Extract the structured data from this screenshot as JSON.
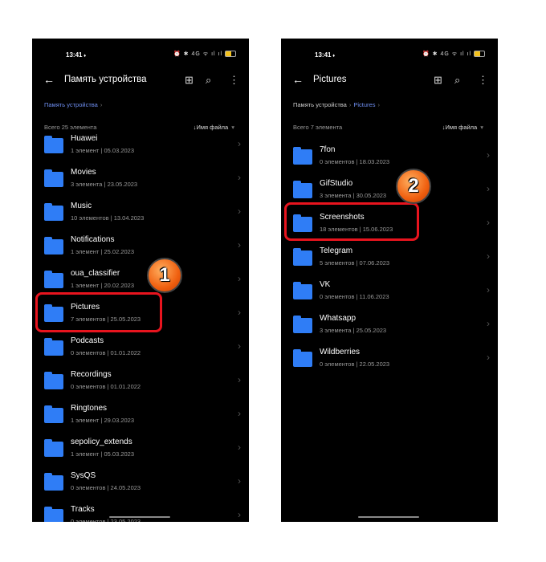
{
  "status": {
    "time": "13:41",
    "icons": "⏰ ✱ 4G ᯤ ıl ıl"
  },
  "left": {
    "title": "Память устройства",
    "breadcrumb": [
      "Память устройства"
    ],
    "total": "Всего 25 элемента",
    "sort": "↓Имя файла",
    "items": [
      {
        "name": "Huawei",
        "meta": "1 элемент  |  05.03.2023"
      },
      {
        "name": "Movies",
        "meta": "3 элемента  |  23.05.2023"
      },
      {
        "name": "Music",
        "meta": "10 элементов  |  13.04.2023"
      },
      {
        "name": "Notifications",
        "meta": "1 элемент  |  25.02.2023"
      },
      {
        "name": "oua_classifier",
        "meta": "1 элемент  |  20.02.2023"
      },
      {
        "name": "Pictures",
        "meta": "7 элементов  |  25.05.2023"
      },
      {
        "name": "Podcasts",
        "meta": "0 элементов  |  01.01.2022"
      },
      {
        "name": "Recordings",
        "meta": "0 элементов  |  01.01.2022"
      },
      {
        "name": "Ringtones",
        "meta": "1 элемент  |  29.03.2023"
      },
      {
        "name": "sepolicy_extends",
        "meta": "1 элемент  |  05.03.2023"
      },
      {
        "name": "SysQS",
        "meta": "0 элементов  |  24.05.2023"
      },
      {
        "name": "Tracks",
        "meta": "0 элементов  |  23.05.2023"
      }
    ]
  },
  "right": {
    "title": "Pictures",
    "breadcrumb": [
      "Память устройства",
      "Pictures"
    ],
    "total": "Всего 7 элемента",
    "sort": "↓Имя файла",
    "items": [
      {
        "name": "7fon",
        "meta": "0 элементов  |  18.03.2023"
      },
      {
        "name": "GifStudio",
        "meta": "3 элемента  |  30.05.2023"
      },
      {
        "name": "Screenshots",
        "meta": "18 элементов  |  15.06.2023"
      },
      {
        "name": "Telegram",
        "meta": "5 элементов  |  07.06.2023"
      },
      {
        "name": "VK",
        "meta": "0 элементов  |  11.06.2023"
      },
      {
        "name": "Whatsapp",
        "meta": "3 элемента  |  25.05.2023"
      },
      {
        "name": "Wildberries",
        "meta": "0 элементов  |  22.05.2023"
      }
    ]
  },
  "badges": [
    "1",
    "2"
  ],
  "colors": {
    "accent": "#6e8ef0",
    "folder": "#2f7df6",
    "highlight": "#e8141e",
    "badge": "#f06010"
  }
}
